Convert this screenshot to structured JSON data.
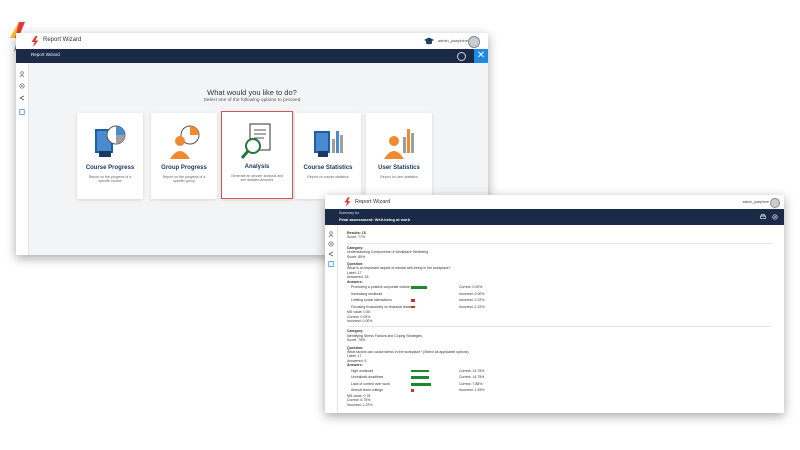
{
  "window1": {
    "app_title": "Report Wizard",
    "user_name": "admin_josephine",
    "nav_title": "Report Wizard",
    "close_glyph": "✕",
    "heading": "What would you like to do?",
    "subheading": "Select one of the following options to proceed",
    "cards": [
      {
        "title": "Course Progress",
        "desc": "Report on the progress of a specific course"
      },
      {
        "title": "Group Progress",
        "desc": "Report on the progress of a specific group"
      },
      {
        "title": "Analysis",
        "desc": "Generate an answer analysis and see detailed answers"
      },
      {
        "title": "Course Statistics",
        "desc": "Report on course statistics"
      },
      {
        "title": "User Statistics",
        "desc": "Report on user statistics"
      }
    ],
    "sidebar_icons": [
      "user-icon",
      "settings-icon",
      "share-icon",
      "report-icon"
    ]
  },
  "window2": {
    "app_title": "Report Wizard",
    "user_name": "admin_josephine",
    "summary_label": "Summary for",
    "summary_title": "Final assessment: Well-being at work",
    "results": {
      "label": "Results: 18",
      "score": "Score: 77%"
    },
    "category1": {
      "label": "Category:",
      "name": "Understanding Components of Workplace Wellbeing",
      "score": "Score: 80%"
    },
    "question1": {
      "label": "Question:",
      "text": "What is an important aspect of mental well-being in the workplace?",
      "label_count": "Label: 17",
      "answered": "Answered: 18",
      "answers_label": "Answers:",
      "answers": [
        {
          "text": "Promoting a positive corporate culture",
          "result": "Correct: 0.00%",
          "pct": 0.88,
          "color": "#1b8a2e"
        },
        {
          "text": "Increasing workload",
          "result": "Incorrect: 0.00%",
          "pct": 0.0,
          "color": "#d32f2f"
        },
        {
          "text": "Limiting social interactions",
          "result": "Incorrect: 2.22%",
          "pct": 0.1,
          "color": "#d32f2f"
        },
        {
          "text": "Focusing exclusively on financial rewards",
          "result": "Incorrect: 2.22%",
          "pct": 0.1,
          "color": "#d32f2f"
        }
      ],
      "ms_value": "MS value: 0.50",
      "correct": "Correct: 0.00%",
      "incorrect": "Incorrect: 0.00%"
    },
    "category2": {
      "label": "Category:",
      "name": "Identifying Stress Factors and Coping Strategies",
      "score": "Score: 75%"
    },
    "question2": {
      "label": "Question:",
      "text": "What factors can cause stress in the workplace? (Select all applicable options)",
      "label_count": "Label: 17",
      "answered": "Answered: 5",
      "answers_label": "Answers:",
      "answers": [
        {
          "text": "High workload",
          "result": "Correct: 14.75%",
          "pct": 0.95,
          "color": "#1b8a2e"
        },
        {
          "text": "Unrealistic deadlines",
          "result": "Correct: 14.75%",
          "pct": 0.95,
          "color": "#1b8a2e"
        },
        {
          "text": "Lack of control over work",
          "result": "Correct: 7.88%",
          "pct": 1.0,
          "color": "#1b8a2e"
        },
        {
          "text": "Annual team outings",
          "result": "Incorrect: 1.53%",
          "pct": 0.1,
          "color": "#d32f2f"
        }
      ],
      "ms_value": "MS value: 0.78",
      "correct": "Correct: 6.75%",
      "incorrect": "Incorrect: 2.22%"
    }
  }
}
